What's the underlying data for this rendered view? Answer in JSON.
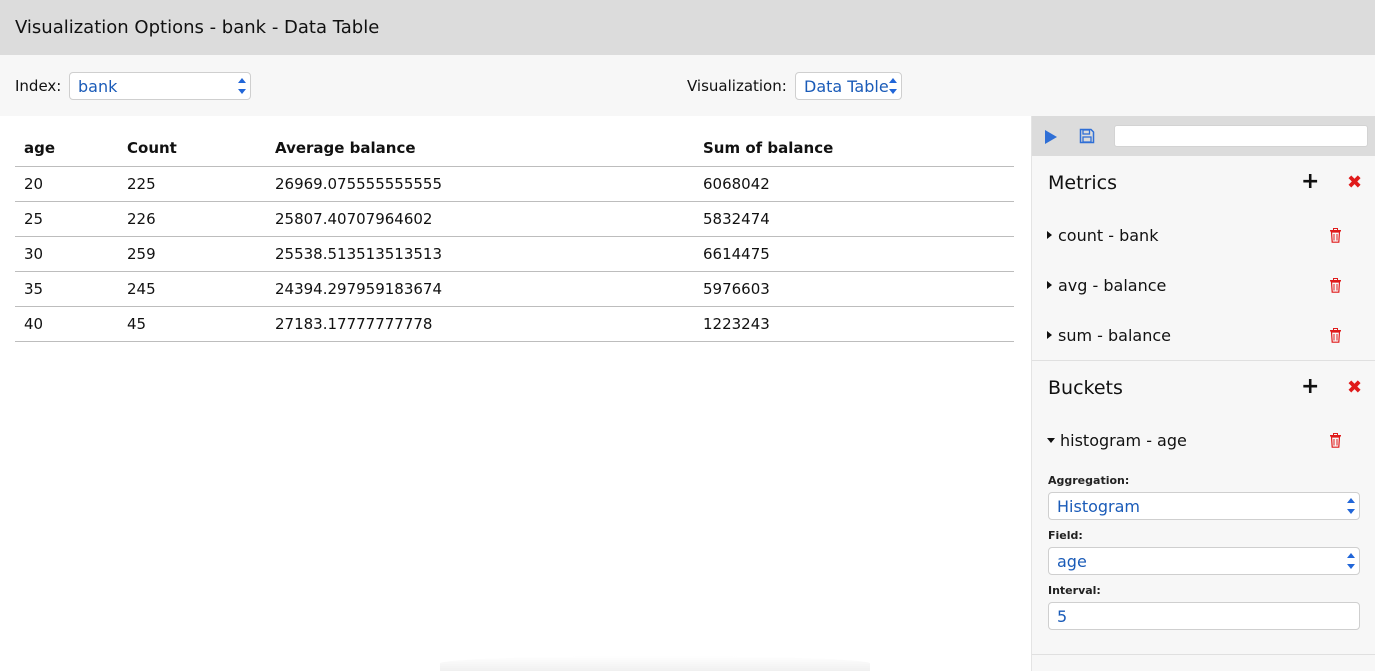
{
  "window": {
    "title": "Visualization Options - bank - Data Table"
  },
  "options": {
    "index_label": "Index:",
    "index_value": "bank",
    "visualization_label": "Visualization:",
    "visualization_value": "Data Table"
  },
  "table": {
    "columns": [
      "age",
      "Count",
      "Average balance",
      "Sum of balance"
    ],
    "rows": [
      [
        "20",
        "225",
        "26969.075555555555",
        "6068042"
      ],
      [
        "25",
        "226",
        "25807.40707964602",
        "5832474"
      ],
      [
        "30",
        "259",
        "25538.513513513513",
        "6614475"
      ],
      [
        "35",
        "245",
        "24394.297959183674",
        "5976603"
      ],
      [
        "40",
        "45",
        "27183.17777777778",
        "1223243"
      ]
    ]
  },
  "sidebar": {
    "toolbar": {
      "play_icon": "play-icon",
      "save_icon": "save-icon",
      "search_value": ""
    },
    "metrics": {
      "title": "Metrics",
      "items": [
        {
          "label": "count - bank"
        },
        {
          "label": "avg - balance"
        },
        {
          "label": "sum - balance"
        }
      ]
    },
    "buckets": {
      "title": "Buckets",
      "items": [
        {
          "label": "histogram - age"
        }
      ],
      "aggregation_label": "Aggregation:",
      "aggregation_value": "Histogram",
      "field_label": "Field:",
      "field_value": "age",
      "interval_label": "Interval:",
      "interval_value": "5"
    }
  },
  "colors": {
    "accent_blue": "#1a5bb8",
    "delete_red": "#e01b1b",
    "header_gray": "#dcdcdc"
  }
}
